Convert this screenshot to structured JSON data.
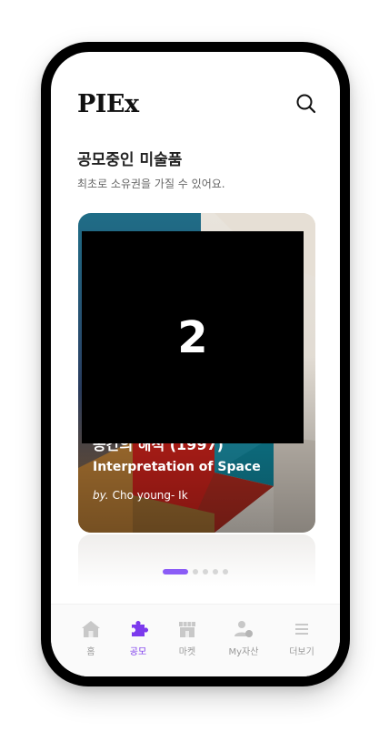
{
  "app": {
    "logo": "PIEx"
  },
  "header": {
    "search_icon": "search-icon"
  },
  "section": {
    "title": "공모중인 미술품",
    "subtitle": "최초로 소유권을 가질 수 있어요."
  },
  "card": {
    "title_ko": "공간의 해석 (1997)",
    "title_en": "Interpretation of Space",
    "artist_prefix": "by.",
    "artist": "Cho young- Ik"
  },
  "overlay": {
    "label": "2"
  },
  "carousel": {
    "total": 5,
    "active_index": 0
  },
  "tabs": [
    {
      "label": "홈",
      "icon": "home-icon",
      "active": false
    },
    {
      "label": "공모",
      "icon": "puzzle-icon",
      "active": true
    },
    {
      "label": "마켓",
      "icon": "store-icon",
      "active": false
    },
    {
      "label": "My자산",
      "icon": "user-coin-icon",
      "active": false
    },
    {
      "label": "더보기",
      "icon": "menu-icon",
      "active": false
    }
  ],
  "colors": {
    "accent": "#7c3aed",
    "dot_active": "#8b5cf6",
    "inactive": "#9a9a9a"
  }
}
